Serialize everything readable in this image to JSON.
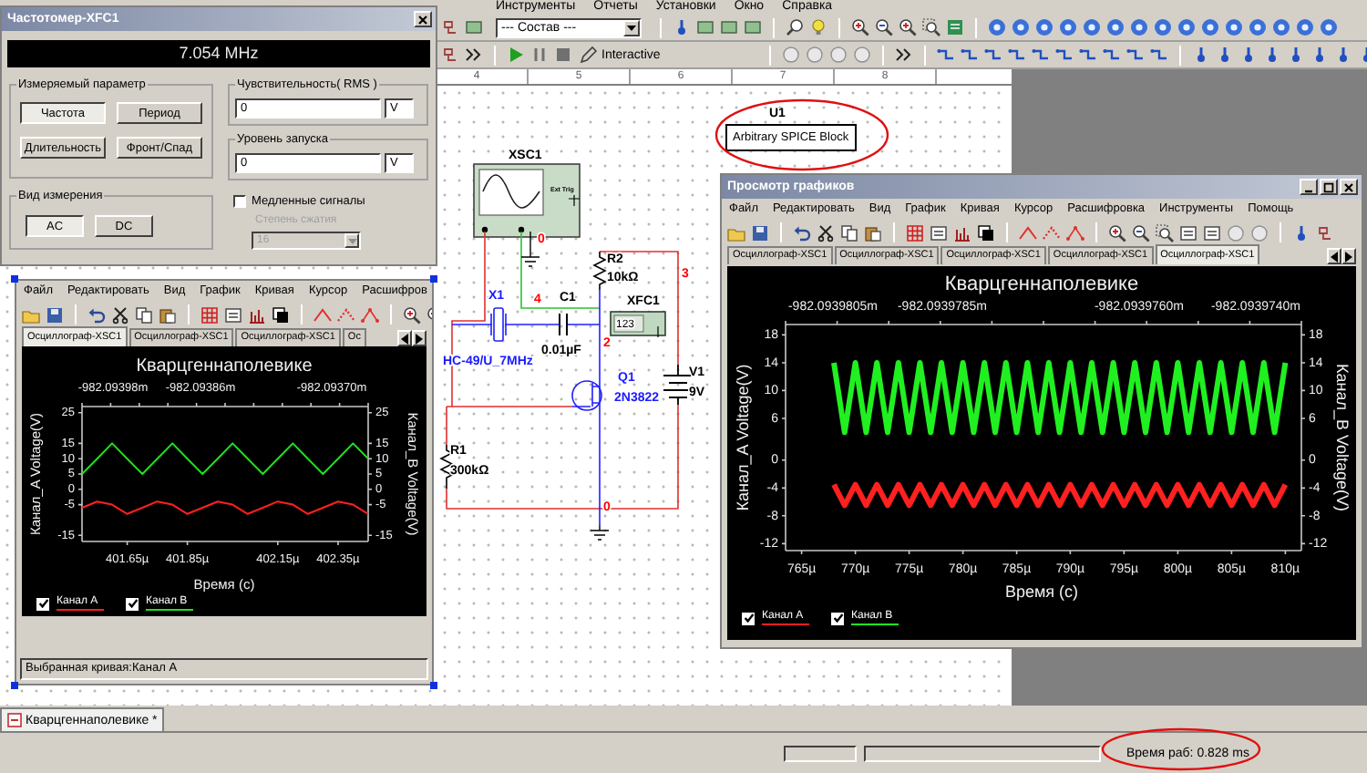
{
  "main_menu": [
    "Инструменты",
    "Отчеты",
    "Установки",
    "Окно",
    "Справка"
  ],
  "toolbar": {
    "component_select": "--- Состав ---",
    "mode": "Interactive"
  },
  "ruler": [
    "4",
    "5",
    "6",
    "7",
    "8"
  ],
  "frequency_counter": {
    "title": "Частотомер-XFC1",
    "reading": "7.054 MHz",
    "parameter_group": "Измеряемый параметр",
    "parameter_buttons": [
      {
        "label": "Частота",
        "selected": true
      },
      {
        "label": "Период",
        "selected": false
      },
      {
        "label": "Длительность",
        "selected": false
      },
      {
        "label": "Фронт/Спад",
        "selected": false
      }
    ],
    "coupling_group": "Вид измерения",
    "coupling_buttons": [
      {
        "label": "AC",
        "selected": true
      },
      {
        "label": "DC",
        "selected": false
      }
    ],
    "sensitivity": {
      "label": "Чувствительность( RMS )",
      "value": "0",
      "unit": "V"
    },
    "trigger_level": {
      "label": "Уровень запуска",
      "value": "0",
      "unit": "V"
    },
    "slow_signals": {
      "label": "Медленные сигналы",
      "checked": false
    },
    "compression": {
      "label": "Степень сжатия",
      "value": "16",
      "disabled": true
    }
  },
  "circuit": {
    "labels": [
      {
        "text": "XSC1",
        "color": "#000000"
      },
      {
        "text": "Ext Trig",
        "color": "#000000"
      },
      {
        "text": "R2",
        "color": "#000000"
      },
      {
        "text": "10kΩ",
        "color": "#000000"
      },
      {
        "text": "X1",
        "color": "#1a1aff"
      },
      {
        "text": "4",
        "color": "#ff0000"
      },
      {
        "text": "C1",
        "color": "#000000"
      },
      {
        "text": "XFC1",
        "color": "#000000"
      },
      {
        "text": "123",
        "color": "#000000"
      },
      {
        "text": "3",
        "color": "#ff0000"
      },
      {
        "text": "2",
        "color": "#ff0000"
      },
      {
        "text": "HC-49/U_7MHz",
        "color": "#1a1aff"
      },
      {
        "text": "0.01µF",
        "color": "#000000"
      },
      {
        "text": "Q1",
        "color": "#1a1aff"
      },
      {
        "text": "2N3822",
        "color": "#1a1aff"
      },
      {
        "text": "V1",
        "color": "#000000"
      },
      {
        "text": "9V",
        "color": "#000000"
      },
      {
        "text": "R1",
        "color": "#000000"
      },
      {
        "text": "300kΩ",
        "color": "#000000"
      },
      {
        "text": "0",
        "color": "#ff0000"
      },
      {
        "text": "0",
        "color": "#ff0000"
      }
    ]
  },
  "spice_block": {
    "ref": "U1",
    "label": "Arbitrary SPICE Block"
  },
  "grapher_small": {
    "menu": [
      "Файл",
      "Редактировать",
      "Вид",
      "График",
      "Кривая",
      "Курсор",
      "Расшифров"
    ],
    "tabs": [
      {
        "label": "Осциллограф-XSC1",
        "selected": true
      },
      {
        "label": "Осциллограф-XSC1",
        "selected": false
      },
      {
        "label": "Осциллограф-XSC1",
        "selected": false
      },
      {
        "label": "Ос",
        "selected": false
      }
    ],
    "chart_data": {
      "type": "line",
      "title": "Кварцгеннаполевике",
      "xlabel": "Время (c)",
      "ylabel": "Канал_A Voltage(V)",
      "x": [
        401.5,
        401.55,
        401.6,
        401.65,
        401.7,
        401.75,
        401.8,
        401.85,
        401.9,
        401.95,
        402,
        402.05,
        402.1,
        402.15,
        402.2,
        402.25,
        402.3,
        402.35,
        402.4,
        402.45
      ],
      "series": [
        {
          "color": "#ff2020",
          "values": [
            -6,
            -4,
            -5,
            -8,
            -6,
            -4,
            -5,
            -8,
            -6,
            -4,
            -5,
            -8,
            -6,
            -4,
            -5,
            -8,
            -6,
            -4,
            -5,
            -8
          ]
        },
        {
          "color": "#20e020",
          "values": [
            5,
            10,
            15,
            10,
            5,
            10,
            15,
            10,
            5,
            10,
            15,
            10,
            5,
            10,
            15,
            10,
            5,
            10,
            15,
            10
          ]
        }
      ],
      "xlim": [
        401.5,
        402.45
      ],
      "ylim": [
        -17,
        27
      ],
      "xticks": [
        {
          "value": 401.65,
          "label": "401.65µ"
        },
        {
          "value": 401.85,
          "label": "401.85µ"
        },
        {
          "value": 402.15,
          "label": "402.15µ"
        },
        {
          "value": 402.35,
          "label": "402.35µ"
        }
      ],
      "yticks": [
        25,
        15,
        10,
        5,
        0,
        -5,
        -15
      ]
    },
    "top_axis_labels": [
      "-982.09398m",
      "-982.09386m",
      "-982.09370m"
    ],
    "right_ylabel": "Канал_B Voltage(V)",
    "right_yticks": [
      "25",
      "15",
      "10",
      "5",
      "0",
      "-5",
      "-15"
    ],
    "legend": [
      {
        "label": "Канал А",
        "color": "#ff2020",
        "checked": true
      },
      {
        "label": "Канал В",
        "color": "#20e020",
        "checked": true
      }
    ],
    "status": "Выбранная кривая:Канал А"
  },
  "grapher": {
    "title": "Просмотр графиков",
    "menu": [
      "Файл",
      "Редактировать",
      "Вид",
      "График",
      "Кривая",
      "Курсор",
      "Расшифровка",
      "Инструменты",
      "Помощь"
    ],
    "tabs": [
      {
        "label": "Осциллограф-XSC1",
        "selected": false
      },
      {
        "label": "Осциллограф-XSC1",
        "selected": false
      },
      {
        "label": "Осциллограф-XSC1",
        "selected": false
      },
      {
        "label": "Осциллограф-XSC1",
        "selected": false
      },
      {
        "label": "Осциллограф-XSC1",
        "selected": true
      }
    ],
    "chart_data": {
      "type": "line",
      "title": "Кварцгеннаполевике",
      "xlabel": "Время (c)",
      "ylabel": "Канал_A Voltage(V)",
      "x": [
        768,
        769,
        770,
        771,
        772,
        773,
        774,
        775,
        776,
        777,
        778,
        779,
        780,
        781,
        782,
        783,
        784,
        785,
        786,
        787,
        788,
        789,
        790,
        791,
        792,
        793,
        794,
        795,
        796,
        797,
        798,
        799,
        800,
        801,
        802,
        803,
        804,
        805,
        806,
        807,
        808,
        809,
        810
      ],
      "series": [
        {
          "color": "#ff2020",
          "values": [
            -3.5,
            -6.5,
            -3.5,
            -6.5,
            -3.5,
            -6.5,
            -3.5,
            -6.5,
            -3.5,
            -6.5,
            -3.5,
            -6.5,
            -3.5,
            -6.5,
            -3.5,
            -6.5,
            -3.5,
            -6.5,
            -3.5,
            -6.5,
            -3.5,
            -6.5,
            -3.5,
            -6.5,
            -3.5,
            -6.5,
            -3.5,
            -6.5,
            -3.5,
            -6.5,
            -3.5,
            -6.5,
            -3.5,
            -6.5,
            -3.5,
            -6.5,
            -3.5,
            -6.5,
            -3.5,
            -6.5,
            -3.5,
            -6.5,
            -3.5
          ]
        },
        {
          "color": "#20f020",
          "values": [
            14,
            4,
            14,
            4,
            14,
            4,
            14,
            4,
            14,
            4,
            14,
            4,
            14,
            4,
            14,
            4,
            14,
            4,
            14,
            4,
            14,
            4,
            14,
            4,
            14,
            4,
            14,
            4,
            14,
            4,
            14,
            4,
            14,
            4,
            14,
            4,
            14,
            4,
            14,
            4,
            14,
            4,
            14
          ]
        }
      ],
      "xlim": [
        763.5,
        811.5
      ],
      "ylim": [
        -13,
        19.5
      ],
      "xticks": [
        {
          "value": 765,
          "label": "765µ"
        },
        {
          "value": 770,
          "label": "770µ"
        },
        {
          "value": 775,
          "label": "775µ"
        },
        {
          "value": 780,
          "label": "780µ"
        },
        {
          "value": 785,
          "label": "785µ"
        },
        {
          "value": 790,
          "label": "790µ"
        },
        {
          "value": 795,
          "label": "795µ"
        },
        {
          "value": 800,
          "label": "800µ"
        },
        {
          "value": 805,
          "label": "805µ"
        },
        {
          "value": 810,
          "label": "810µ"
        }
      ],
      "yticks": [
        18,
        14,
        10,
        6,
        0,
        -4,
        -8,
        -12
      ]
    },
    "top_axis_labels": [
      "-982.0939805m",
      "-982.0939785m",
      "-982.0939760m",
      "-982.0939740m"
    ],
    "right_ylabel": "Канал_B Voltage(V)",
    "right_yticks": [
      "18",
      "14",
      "10",
      "6",
      "0",
      "-4",
      "-8",
      "-12"
    ],
    "legend": [
      {
        "label": "Канал А",
        "color": "#ff2020",
        "checked": true
      },
      {
        "label": "Канал В",
        "color": "#20f020",
        "checked": true
      }
    ]
  },
  "document_tab": {
    "label": "Кварцгеннаполевике *",
    "selected": true
  },
  "status_bar": {
    "run_time": "Время раб: 0.828 ms"
  }
}
